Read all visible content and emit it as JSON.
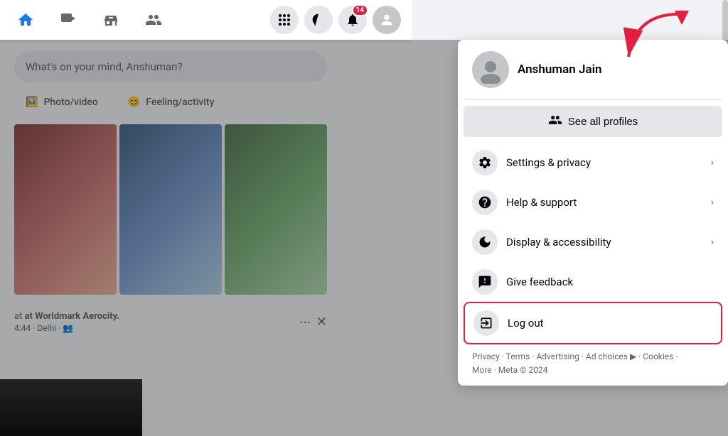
{
  "navbar": {
    "icons": [
      {
        "name": "home-icon",
        "symbol": "⊞"
      },
      {
        "name": "watch-icon",
        "symbol": "▶"
      },
      {
        "name": "marketplace-icon",
        "symbol": "🏪"
      },
      {
        "name": "friends-icon",
        "symbol": "👥"
      }
    ],
    "right_icons": [
      {
        "name": "grid-icon",
        "symbol": "⊞",
        "badge": null
      },
      {
        "name": "messenger-icon",
        "symbol": "💬",
        "badge": null
      },
      {
        "name": "notifications-icon",
        "symbol": "🔔",
        "badge": "14"
      },
      {
        "name": "account-icon",
        "symbol": "👤",
        "badge": null
      }
    ]
  },
  "search": {
    "placeholder": "What's on your mind, Anshuman?"
  },
  "post_actions": [
    {
      "label": "Photo/video",
      "icon": "📷"
    },
    {
      "label": "Feeling/activity",
      "icon": "😊"
    }
  ],
  "post_footer": {
    "location": "at Worldmark Aerocity.",
    "meta": "4:44 · Delhi · 👥"
  },
  "dropdown": {
    "profile": {
      "name": "Anshuman Jain"
    },
    "see_all_profiles": "See all profiles",
    "menu_items": [
      {
        "id": "settings-privacy",
        "icon": "⚙️",
        "label": "Settings & privacy",
        "has_chevron": true
      },
      {
        "id": "help-support",
        "icon": "❓",
        "label": "Help & support",
        "has_chevron": true
      },
      {
        "id": "display-accessibility",
        "icon": "🌙",
        "label": "Display & accessibility",
        "has_chevron": true
      },
      {
        "id": "give-feedback",
        "icon": "💬",
        "label": "Give feedback",
        "has_chevron": false
      }
    ],
    "logout": {
      "icon": "🚪",
      "label": "Log out"
    },
    "footer": {
      "links": [
        "Privacy",
        "Terms",
        "Advertising",
        "Ad choices",
        "Cookies",
        "More"
      ],
      "copyright": "Meta © 2024",
      "separator": " · "
    }
  }
}
